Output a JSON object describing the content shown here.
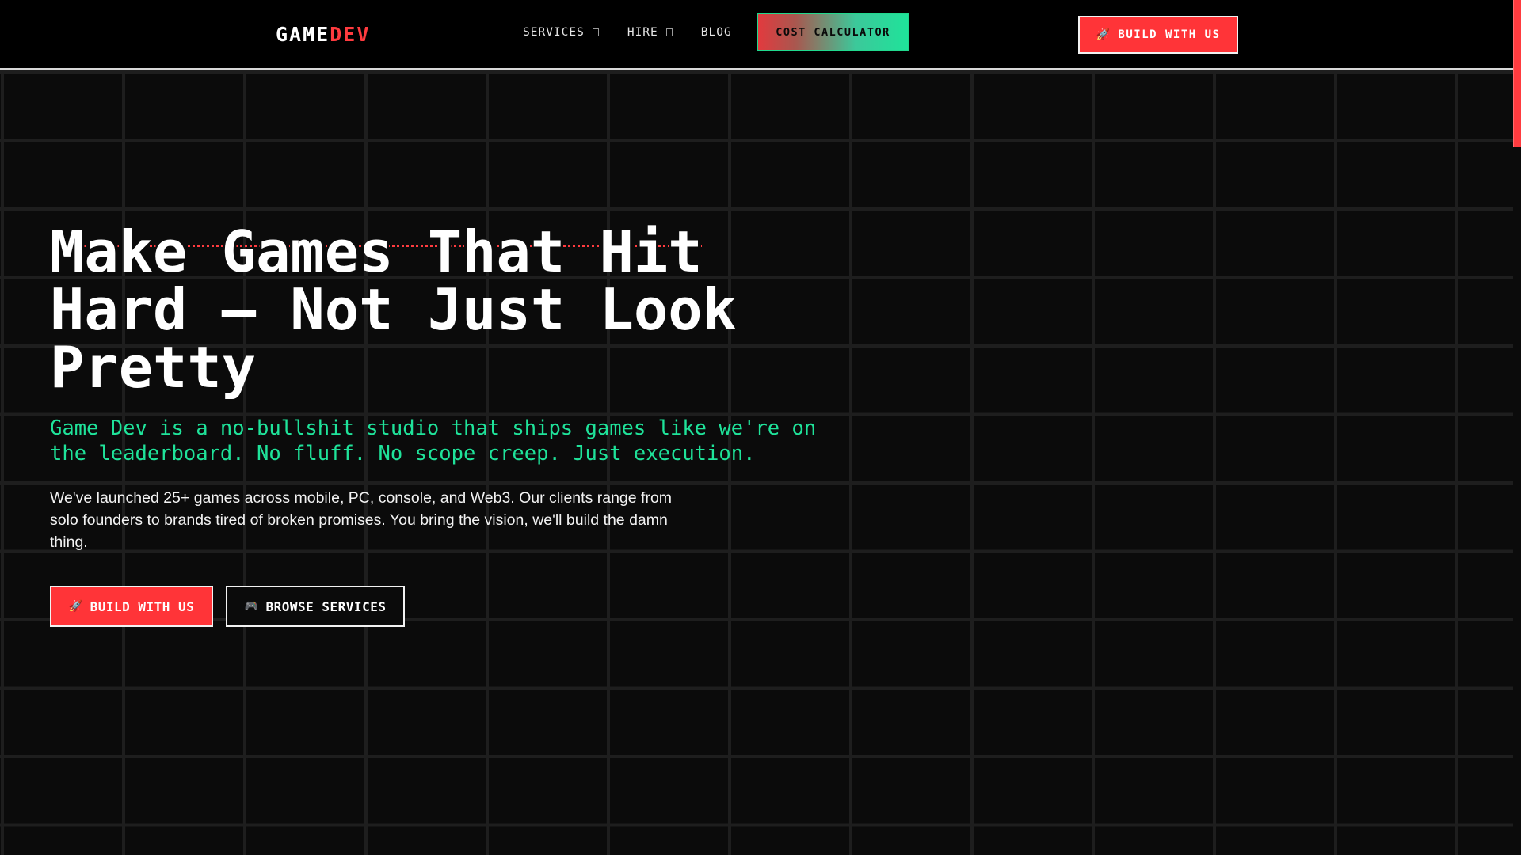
{
  "header": {
    "logo_main": "GAME",
    "logo_accent": "DEV",
    "nav": [
      {
        "label": "SERVICES",
        "has_dropdown": true
      },
      {
        "label": "HIRE",
        "has_dropdown": true
      },
      {
        "label": "BLOG",
        "has_dropdown": false
      }
    ],
    "cost_calculator_label": "COST CALCULATOR",
    "cta_icon": "rocket-icon",
    "cta_label": "BUILD WITH US"
  },
  "hero": {
    "headline_line1": "Make Games That Hit",
    "headline_line2": "Hard — Not Just Look",
    "headline_line3": "Pretty",
    "subhead": "Game Dev is a no-bullshit studio that ships games like we're on the leaderboard. No fluff. No scope creep. Just execution.",
    "body": "We've launched 25+ games across mobile, PC, console, and Web3. Our clients range from solo founders to brands tired of broken promises. You bring the vision, we'll build the damn thing.",
    "primary_cta": {
      "icon": "rocket-icon",
      "label": "BUILD WITH US"
    },
    "secondary_cta": {
      "icon": "gamepad-icon",
      "label": "BROWSE SERVICES"
    }
  },
  "colors": {
    "accent_red": "#ff3438",
    "accent_green": "#1fe39a",
    "background": "#0b0b0b"
  }
}
